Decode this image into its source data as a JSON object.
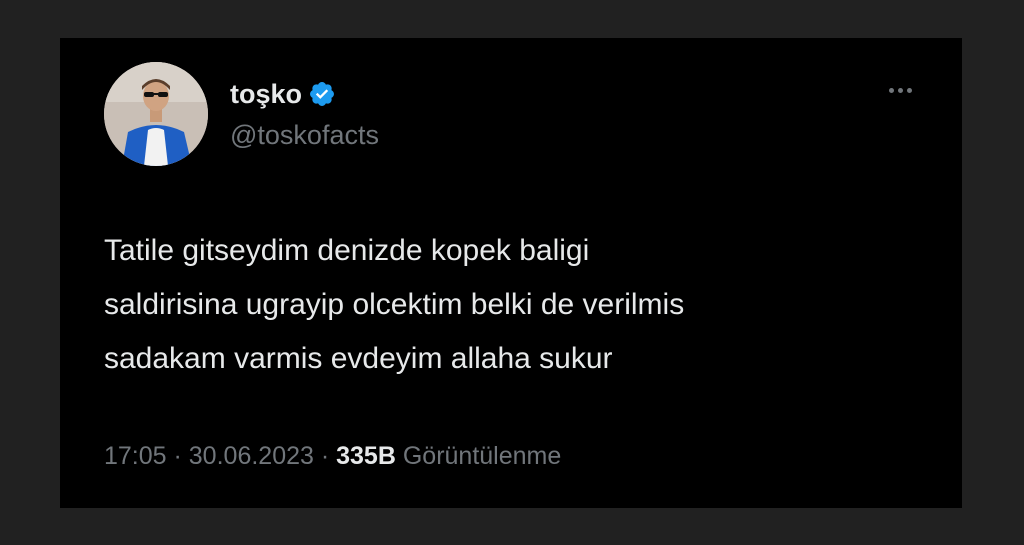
{
  "tweet": {
    "author": {
      "display_name": "toşko",
      "handle": "@toskofacts",
      "verified": true,
      "verified_color": "#1d9bf0"
    },
    "text_lines": [
      "Tatile gitseydim denizde kopek baligi",
      "saldirisina ugrayip olcektim belki de verilmis",
      "sadakam varmis evdeyim allaha sukur"
    ],
    "time": "17:05",
    "separator": " · ",
    "date": "30.06.2023",
    "views_count": "335B",
    "views_label": "Görüntülenme"
  },
  "icons": {
    "more": "more-dots-icon",
    "verified": "verified-badge-icon"
  },
  "colors": {
    "background": "#212121",
    "card": "#000000",
    "primary_text": "#e7e9ea",
    "secondary_text": "#71767b"
  }
}
